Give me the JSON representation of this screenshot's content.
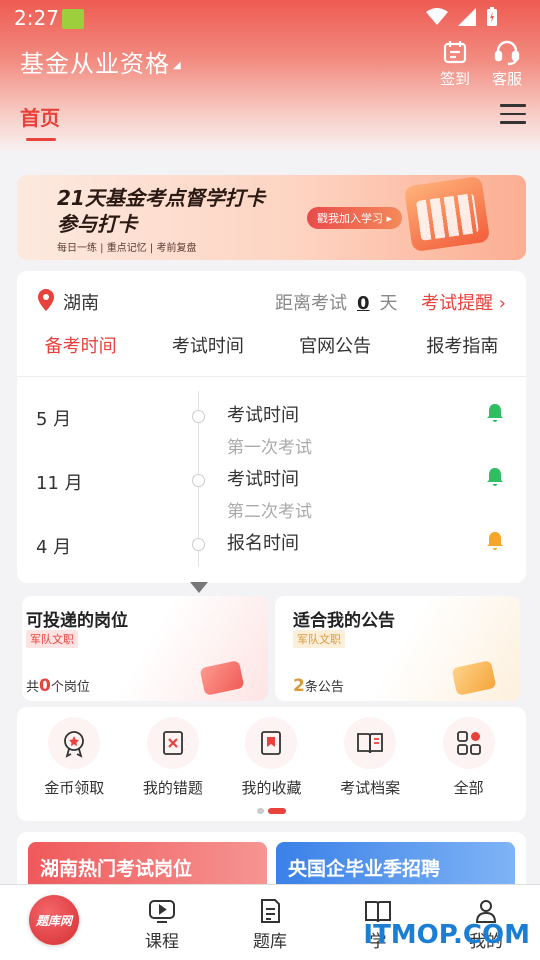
{
  "status": {
    "time": "2:27"
  },
  "header": {
    "title": "基金从业资格",
    "actions": [
      {
        "label": "签到",
        "icon": "calendar-icon"
      },
      {
        "label": "客服",
        "icon": "headset-icon"
      }
    ]
  },
  "tabs": {
    "home": "首页"
  },
  "banner": {
    "line1": "21天基金考点督学打卡",
    "line2": "参与打卡",
    "cta": "戳我加入学习 ▸",
    "tags": "每日一练 | 重点记忆 | 考前复盘"
  },
  "exam": {
    "location": "湖南",
    "countdown_prefix": "距离考试",
    "countdown_days": "0",
    "countdown_unit": "天",
    "reminder": "考试提醒 ›",
    "tabs": [
      "备考时间",
      "考试时间",
      "官网公告",
      "报考指南"
    ],
    "timeline": [
      {
        "month": "5 月",
        "label": "考试时间",
        "sub": "第一次考试",
        "bell_color": "#2fbf62"
      },
      {
        "month": "11 月",
        "label": "考试时间",
        "sub": "第二次考试",
        "bell_color": "#2fbf62"
      },
      {
        "month": "4 月",
        "label": "报名时间",
        "sub": "",
        "bell_color": "#f4a62a"
      }
    ]
  },
  "jobs": {
    "left": {
      "title": "可投递的岗位",
      "tag": "军队文职",
      "count_prefix": "共",
      "count": "0",
      "count_suffix": "个岗位"
    },
    "right": {
      "title": "适合我的公告",
      "tag": "军队文职",
      "count_prefix": "",
      "count": "2",
      "count_suffix": "条公告"
    }
  },
  "quick": [
    {
      "label": "金币领取",
      "icon": "coin-medal-icon"
    },
    {
      "label": "我的错题",
      "icon": "wrong-book-icon"
    },
    {
      "label": "我的收藏",
      "icon": "bookmark-book-icon"
    },
    {
      "label": "考试档案",
      "icon": "open-book-icon"
    },
    {
      "label": "全部",
      "icon": "grid-icon"
    }
  ],
  "promos": {
    "left": "湖南热门考试岗位",
    "right": "央国企毕业季招聘"
  },
  "nav": {
    "logo": "题库网",
    "items": [
      {
        "label": "课程",
        "icon": "play-icon"
      },
      {
        "label": "题库",
        "icon": "notebook-icon"
      },
      {
        "label": "学",
        "icon": "book-icon"
      },
      {
        "label": "我的",
        "icon": "person-icon"
      }
    ]
  },
  "watermark": "ITMOP.COM",
  "colors": {
    "accent": "#e9423c",
    "green_bell": "#2fbf62",
    "orange_bell": "#f4a62a"
  }
}
